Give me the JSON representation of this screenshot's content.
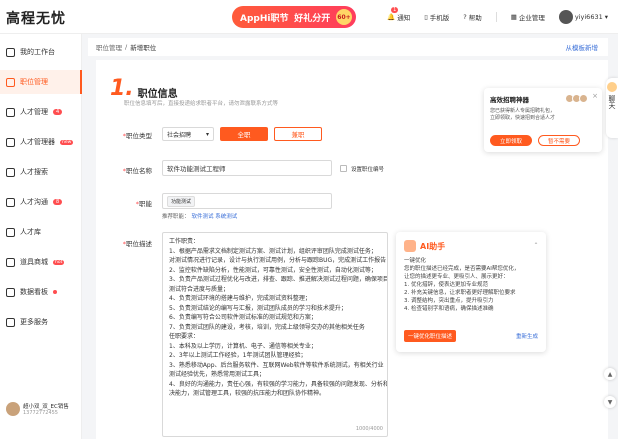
{
  "app": {
    "logo": "高程无忧"
  },
  "promo": {
    "label": "AppHi职节",
    "sub": "好礼分开",
    "badge": "60+"
  },
  "top_nav": {
    "notify": "通知",
    "notify_badge": "1",
    "handbook": "手机版",
    "help": "帮助",
    "enterprise": "企业管理",
    "user": "yiyi6631"
  },
  "sidebar": {
    "items": [
      {
        "label": "我的工作台"
      },
      {
        "label": "职位管理"
      },
      {
        "label": "人才管理",
        "count": "4"
      },
      {
        "label": "人才管理器",
        "badge": "new"
      },
      {
        "label": "人才搜索"
      },
      {
        "label": "人才沟通",
        "count": "8"
      },
      {
        "label": "人才库"
      },
      {
        "label": "道具商城",
        "badge": "hot"
      },
      {
        "label": "数据看板"
      },
      {
        "label": "更多服务"
      }
    ],
    "user_name": "超小双_双_EC销售",
    "user_phone": "13772772455"
  },
  "breadcrumb": {
    "path1": "职位管理",
    "sep": "/",
    "path2": "新增职位",
    "back": "从模板新增"
  },
  "section": {
    "num": "1.",
    "title": "职位信息",
    "subtitle": "职位信息填写后，直接投递给求职者平台，请勿泄露联系方式等"
  },
  "form": {
    "job_type_label": "职位类型",
    "job_type_value": "社会招聘",
    "job_type_full": "全职",
    "job_type_part": "兼职",
    "job_name_label": "职位名称",
    "job_name_value": "软件功能测试工程师",
    "set_code_label": "设置职位编号",
    "category_label": "职能",
    "category_tag": "功能测试",
    "hint_prefix": "推荐职能：",
    "hint_links": "软件测试 系统测试",
    "desc_label": "职位描述",
    "counter": "1000/4000"
  },
  "description": [
    "工作职责：",
    "1、根据产品需求文档制定测试方案、测试计划，组织评审团队完成测试任务；",
    "对测试情况进行记录，设计与执行测试用例，分析与跟踪BUG，完成测试工作报告；",
    "2、监控软件缺陷分析，性能测试，可靠性测试，安全性测试，自动化测试等；",
    "3、负责产品测试过程优化与改进，排查、跟踪、推进解决测试过程问题，确保项目",
    "测试符合进度与质量；",
    "4、负责测试环境的搭建与维护，完成测试资料整理；",
    "5、负责测试结论的编写与汇报，测试团队成员的学习和技术提升；",
    "6、负责编写符合公司软件测试标准的测试规范和方案；",
    "7、负责测试团队的建设，考核，培训，完成上级领导交办的其他相关任务",
    "任职要求：",
    "1、本科及以上学历，计算机、电子、通信等相关专业；",
    "2、3年以上测试工作经验，1年测试团队管理经验；",
    "3、熟悉移动App、后台服务软件、互联网Web软件等软件系统测试，有相关行业",
    "测试经验优先，熟悉常用测试工具；",
    "4、良好的沟通能力，责任心强，有较强的学习能力，具备较强的问题发现、分析和解",
    "决能力，测试管理工具，较强的抗压能力和团队协作精神。"
  ],
  "ai_panel": {
    "title": "AI助手",
    "lines": [
      "一键优化",
      "您的职位描述已经完成，是否需要AI帮您优化，",
      "让您的描述更专业、更吸引人、展示更好：",
      "1. 优化措辞，使表达更加专业规范",
      "2. 补充关键信息，让求职者更好理解职位要求",
      "3. 调整结构，突出重点，提升吸引力",
      "4. 检查错别字和语病，确保描述准确"
    ],
    "button": "一键优化职位描述",
    "link": "重新生成"
  },
  "popup": {
    "title": "高效招聘神器",
    "lines": [
      "您已获得新人专属招聘礼包，",
      "立即领取，快速招到合适人才"
    ],
    "btn1": "立即领取",
    "btn2": "暂不需要"
  },
  "rail": {
    "text": "聊天"
  },
  "colors": {
    "accent": "#ff5a1f",
    "link": "#3a6fd8",
    "badge": "#ff4d4f"
  }
}
